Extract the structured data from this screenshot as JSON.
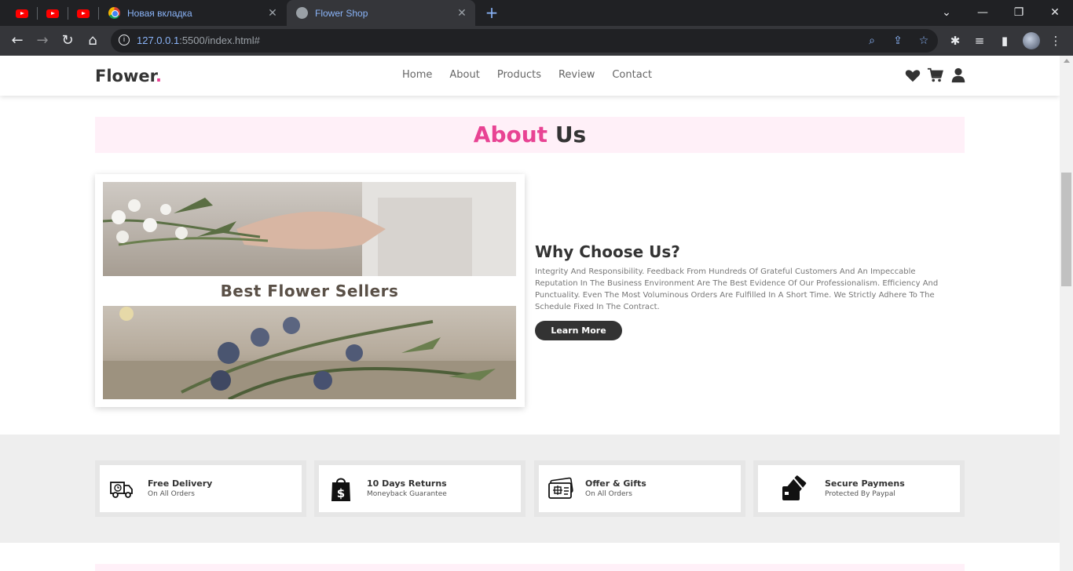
{
  "browser": {
    "tabs": [
      {
        "title": "Новая вкладка",
        "active": false
      },
      {
        "title": "Flower Shop",
        "active": true
      }
    ],
    "address": {
      "host": "127.0.0.1",
      "rest": ":5500/index.html#"
    }
  },
  "site": {
    "logo_text": "Flower",
    "logo_dot": ".",
    "nav": [
      "Home",
      "About",
      "Products",
      "Review",
      "Contact"
    ],
    "header_icons": [
      "heart-icon",
      "cart-icon",
      "user-icon"
    ]
  },
  "about": {
    "heading_highlight": "About",
    "heading_rest": "Us",
    "video_caption": "Best Flower Sellers",
    "why_title": "Why Choose Us?",
    "why_text": "Integrity And Responsibility. Feedback From Hundreds Of Grateful Customers And An Impeccable Reputation In The Business Environment Are The Best Evidence Of Our Professionalism. Efficiency And Punctuality. Even The Most Voluminous Orders Are Fulfilled In A Short Time. We Strictly Adhere To The Schedule Fixed In The Contract.",
    "learn_more": "Learn More"
  },
  "features": [
    {
      "title": "Free Delivery",
      "subtitle": "On All Orders",
      "icon": "truck-icon"
    },
    {
      "title": "10 Days Returns",
      "subtitle": "Moneyback Guarantee",
      "icon": "shopping-bag-icon"
    },
    {
      "title": "Offer & Gifts",
      "subtitle": "On All Orders",
      "icon": "gift-card-icon"
    },
    {
      "title": "Secure Paymens",
      "subtitle": "Protected By Paypal",
      "icon": "credit-card-icon"
    }
  ],
  "colors": {
    "accent": "#e84393",
    "dark": "#333333",
    "pink_bg": "#fff0f8"
  }
}
